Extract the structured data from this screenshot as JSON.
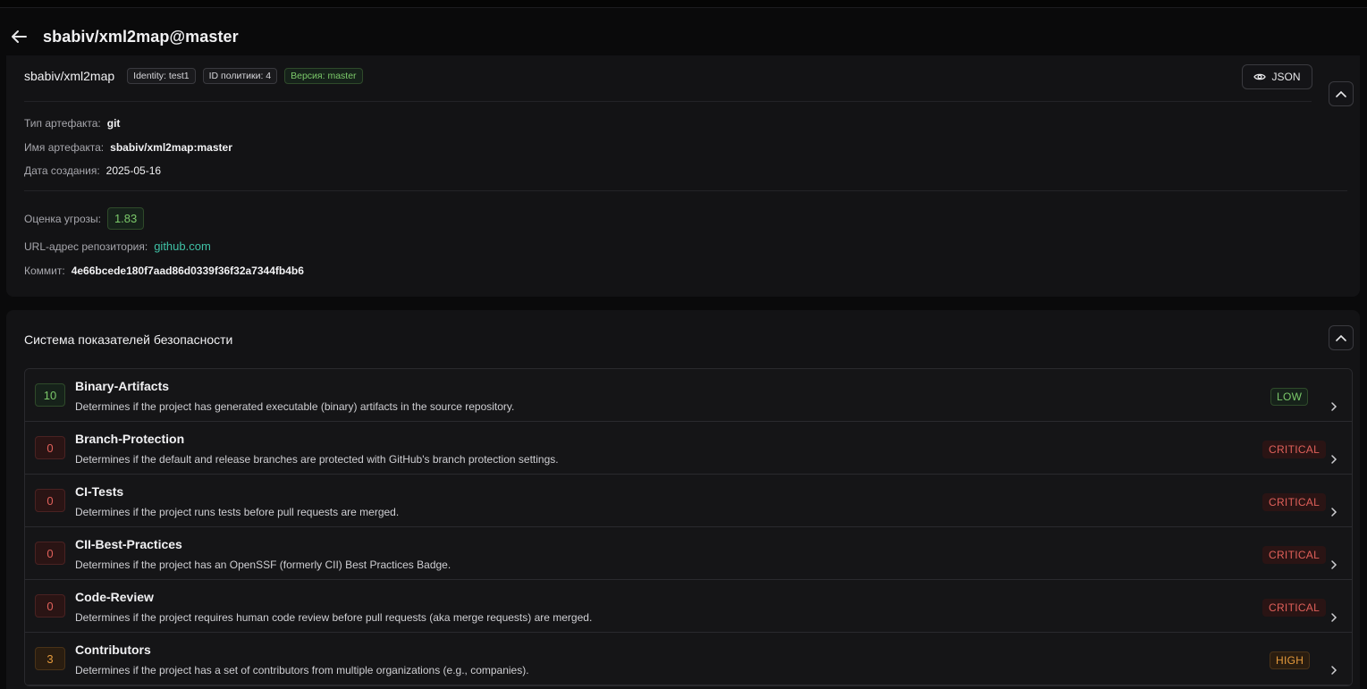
{
  "header": {
    "title": "sbabiv/xml2map@master"
  },
  "info": {
    "repo_name": "sbabiv/xml2map",
    "badges": [
      "Identity: test1",
      "ID политики: 4",
      "Версия: master"
    ],
    "json_label": "JSON",
    "artifact_type_label": "Тип артефакта:",
    "artifact_type_value": "git",
    "artifact_name_label": "Имя артефакта:",
    "artifact_name_value": "sbabiv/xml2map:master",
    "created_label": "Дата создания:",
    "created_value": "2025-05-16",
    "threat_label": "Оценка угрозы:",
    "threat_value": "1.83",
    "repo_url_label": "URL-адрес репозитория:",
    "repo_url_value": "github.com",
    "commit_label": "Коммит:",
    "commit_value": "4e66bcede180f7aad86d0339f36f32a7344fb4b6"
  },
  "scorecard": {
    "title": "Система показателей безопасности",
    "checks": [
      {
        "score": "10",
        "name": "Binary-Artifacts",
        "desc": "Determines if the project has generated executable (binary) artifacts in the source repository.",
        "risk": "LOW",
        "level": "low"
      },
      {
        "score": "0",
        "name": "Branch-Protection",
        "desc": "Determines if the default and release branches are protected with GitHub's branch protection settings.",
        "risk": "CRITICAL",
        "level": "crit"
      },
      {
        "score": "0",
        "name": "CI-Tests",
        "desc": "Determines if the project runs tests before pull requests are merged.",
        "risk": "CRITICAL",
        "level": "crit"
      },
      {
        "score": "0",
        "name": "CII-Best-Practices",
        "desc": "Determines if the project has an OpenSSF (formerly CII) Best Practices Badge.",
        "risk": "CRITICAL",
        "level": "crit"
      },
      {
        "score": "0",
        "name": "Code-Review",
        "desc": "Determines if the project requires human code review before pull requests (aka merge requests) are merged.",
        "risk": "CRITICAL",
        "level": "crit"
      },
      {
        "score": "3",
        "name": "Contributors",
        "desc": "Determines if the project has a set of contributors from multiple organizations (e.g., companies).",
        "risk": "HIGH",
        "level": "high"
      }
    ]
  },
  "colors": {
    "bg": "#0a0a0b",
    "card": "#131315",
    "low": "#7bc96a",
    "critical": "#e0605a",
    "high": "#e59a3c",
    "link": "#3fc1a5"
  },
  "icons": {
    "back": "arrow-left-icon",
    "json": "eye-icon",
    "collapse": "chevron-up-icon",
    "row": "chevron-right-icon"
  }
}
